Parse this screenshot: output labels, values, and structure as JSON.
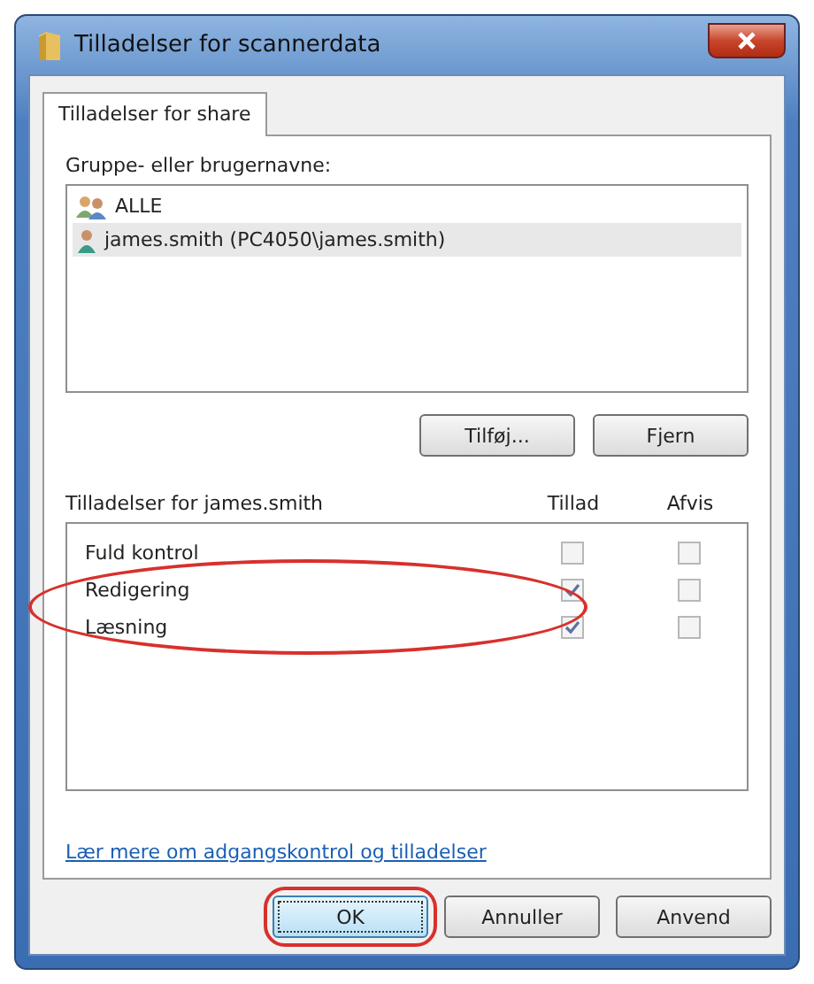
{
  "window": {
    "title": "Tilladelser for scannerdata"
  },
  "tabs": [
    {
      "label": "Tilladelser for share",
      "selected": true
    }
  ],
  "groups": {
    "label": "Gruppe- eller brugernavne:",
    "items": [
      {
        "kind": "group",
        "name": "ALLE",
        "selected": false
      },
      {
        "kind": "user",
        "name": "james.smith (PC4050\\james.smith)",
        "selected": true
      }
    ]
  },
  "group_buttons": [
    "Tilføj...",
    "Fjern"
  ],
  "permissions": {
    "label": "Tilladelser for james.smith",
    "allow_header": "Tillad",
    "deny_header": "Afvis",
    "rows": [
      {
        "name": "Fuld kontrol",
        "allow": {
          "checked": false,
          "disabled": true
        },
        "deny": {
          "checked": false,
          "disabled": true
        },
        "circled": false
      },
      {
        "name": "Redigering",
        "allow": {
          "checked": true,
          "disabled": true
        },
        "deny": {
          "checked": false,
          "disabled": true
        },
        "circled": true
      },
      {
        "name": "Læsning",
        "allow": {
          "checked": true,
          "disabled": true
        },
        "deny": {
          "checked": false,
          "disabled": true
        },
        "circled": true
      }
    ]
  },
  "link": "Lær mere om adgangskontrol og tilladelser",
  "buttons": [
    {
      "label": "OK",
      "default": true,
      "circled": true
    },
    {
      "label": "Annuller",
      "default": false,
      "circled": false
    },
    {
      "label": "Anvend",
      "default": false,
      "circled": false
    }
  ]
}
